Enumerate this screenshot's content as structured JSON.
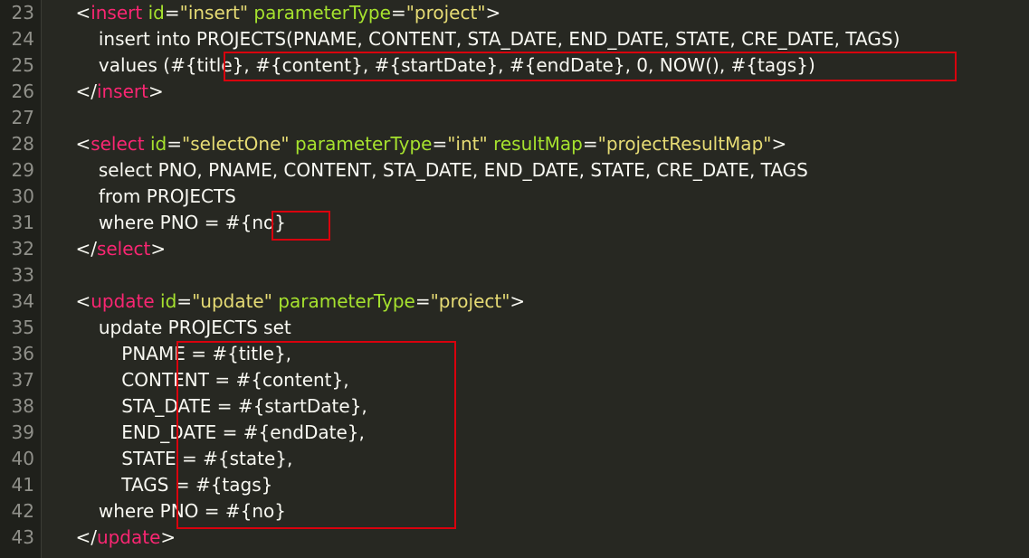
{
  "editor": {
    "lines": [
      {
        "number": "23",
        "tokens": [
          {
            "text": "    ",
            "k": "p"
          },
          {
            "text": "<",
            "k": "p"
          },
          {
            "text": "insert",
            "k": "t"
          },
          {
            "text": " ",
            "k": "p"
          },
          {
            "text": "id",
            "k": "a"
          },
          {
            "text": "=",
            "k": "p"
          },
          {
            "text": "\"insert\"",
            "k": "s"
          },
          {
            "text": " ",
            "k": "p"
          },
          {
            "text": "parameterType",
            "k": "a"
          },
          {
            "text": "=",
            "k": "p"
          },
          {
            "text": "\"project\"",
            "k": "s"
          },
          {
            "text": ">",
            "k": "p"
          }
        ]
      },
      {
        "number": "24",
        "tokens": [
          {
            "text": "        insert into PROJECTS(PNAME, CONTENT, STA_DATE, END_DATE, STATE, CRE_DATE, TAGS)",
            "k": "p"
          }
        ]
      },
      {
        "number": "25",
        "tokens": [
          {
            "text": "        values (#{title}, #{content}, #{startDate}, #{endDate}, 0, NOW(), #{tags})",
            "k": "p"
          }
        ]
      },
      {
        "number": "26",
        "tokens": [
          {
            "text": "    ",
            "k": "p"
          },
          {
            "text": "</",
            "k": "p"
          },
          {
            "text": "insert",
            "k": "t"
          },
          {
            "text": ">",
            "k": "p"
          }
        ]
      },
      {
        "number": "27",
        "tokens": []
      },
      {
        "number": "28",
        "tokens": [
          {
            "text": "    ",
            "k": "p"
          },
          {
            "text": "<",
            "k": "p"
          },
          {
            "text": "select",
            "k": "t"
          },
          {
            "text": " ",
            "k": "p"
          },
          {
            "text": "id",
            "k": "a"
          },
          {
            "text": "=",
            "k": "p"
          },
          {
            "text": "\"selectOne\"",
            "k": "s"
          },
          {
            "text": " ",
            "k": "p"
          },
          {
            "text": "parameterType",
            "k": "a"
          },
          {
            "text": "=",
            "k": "p"
          },
          {
            "text": "\"int\"",
            "k": "s"
          },
          {
            "text": " ",
            "k": "p"
          },
          {
            "text": "resultMap",
            "k": "a"
          },
          {
            "text": "=",
            "k": "p"
          },
          {
            "text": "\"projectResultMap\"",
            "k": "s"
          },
          {
            "text": ">",
            "k": "p"
          }
        ]
      },
      {
        "number": "29",
        "tokens": [
          {
            "text": "        select PNO, PNAME, CONTENT, STA_DATE, END_DATE, STATE, CRE_DATE, TAGS",
            "k": "p"
          }
        ]
      },
      {
        "number": "30",
        "tokens": [
          {
            "text": "        from PROJECTS",
            "k": "p"
          }
        ]
      },
      {
        "number": "31",
        "tokens": [
          {
            "text": "        where PNO = #{no}",
            "k": "p"
          }
        ]
      },
      {
        "number": "32",
        "tokens": [
          {
            "text": "    ",
            "k": "p"
          },
          {
            "text": "</",
            "k": "p"
          },
          {
            "text": "select",
            "k": "t"
          },
          {
            "text": ">",
            "k": "p"
          }
        ]
      },
      {
        "number": "33",
        "tokens": []
      },
      {
        "number": "34",
        "tokens": [
          {
            "text": "    ",
            "k": "p"
          },
          {
            "text": "<",
            "k": "p"
          },
          {
            "text": "update",
            "k": "t"
          },
          {
            "text": " ",
            "k": "p"
          },
          {
            "text": "id",
            "k": "a"
          },
          {
            "text": "=",
            "k": "p"
          },
          {
            "text": "\"update\"",
            "k": "s"
          },
          {
            "text": " ",
            "k": "p"
          },
          {
            "text": "parameterType",
            "k": "a"
          },
          {
            "text": "=",
            "k": "p"
          },
          {
            "text": "\"project\"",
            "k": "s"
          },
          {
            "text": ">",
            "k": "p"
          }
        ]
      },
      {
        "number": "35",
        "tokens": [
          {
            "text": "        update PROJECTS set",
            "k": "p"
          }
        ]
      },
      {
        "number": "36",
        "tokens": [
          {
            "text": "            PNAME = #{title},",
            "k": "p"
          }
        ]
      },
      {
        "number": "37",
        "tokens": [
          {
            "text": "            CONTENT = #{content},",
            "k": "p"
          }
        ]
      },
      {
        "number": "38",
        "tokens": [
          {
            "text": "            STA_DATE = #{startDate},",
            "k": "p"
          }
        ]
      },
      {
        "number": "39",
        "tokens": [
          {
            "text": "            END_DATE = #{endDate},",
            "k": "p"
          }
        ]
      },
      {
        "number": "40",
        "tokens": [
          {
            "text": "            STATE = #{state},",
            "k": "p"
          }
        ]
      },
      {
        "number": "41",
        "tokens": [
          {
            "text": "            TAGS = #{tags}",
            "k": "p"
          }
        ]
      },
      {
        "number": "42",
        "tokens": [
          {
            "text": "        where PNO = #{no}",
            "k": "p"
          }
        ]
      },
      {
        "number": "43",
        "tokens": [
          {
            "text": "    ",
            "k": "p"
          },
          {
            "text": "</",
            "k": "p"
          },
          {
            "text": "update",
            "k": "t"
          },
          {
            "text": ">",
            "k": "p"
          }
        ]
      }
    ]
  },
  "colors": {
    "background": "#272822",
    "gutter": "#1f201b",
    "line_number": "#90908a",
    "plain": "#f8f8f2",
    "tag": "#f92672",
    "attribute": "#a6e22e",
    "string": "#e6db74",
    "highlight_box": "#d9000d"
  }
}
